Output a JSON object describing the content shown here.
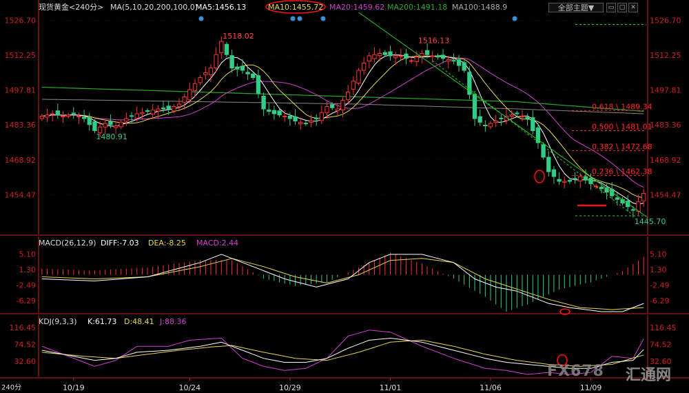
{
  "header": {
    "title": "现货黄金<240分>",
    "ma_params": "MA(5,10,20,200,100,0)",
    "ma5": "MA5:1456.13",
    "ma10": "MA10:1455.72",
    "ma20": "MA20:1459.62",
    "ma200": "MA200:1491.18",
    "ma100": "MA100:1488.9",
    "theme_button": "全部主题▼"
  },
  "macd_header": {
    "params": "MACD(26,12,9)",
    "diff": "DIFF:-7.03",
    "dea": "DEA:-8.25",
    "macd": "MACD:2.44"
  },
  "kdj_header": {
    "params": "KDJ(9,3,3)",
    "k": "K:61.73",
    "d": "D:48.41",
    "j": "J:88.36"
  },
  "period_label": "240分",
  "watermark": {
    "text": "FX678",
    "cn": "汇通网"
  },
  "colors": {
    "up": "#ff3333",
    "down": "#33cc88",
    "ma5": "#ffffff",
    "ma10": "#e8d84a",
    "ma20": "#d040d0",
    "ma200": "#2aaa2a",
    "ma100": "#888888",
    "axis": "#cc2222",
    "annot": "#ff2a2a"
  },
  "chart_data": [
    {
      "type": "candlestick",
      "title": "现货黄金<240分>",
      "y_ticks": [
        1526.7,
        1512.25,
        1497.81,
        1483.36,
        1468.92,
        1454.47
      ],
      "y_tick_labels": [
        "1526.70",
        "1512.25",
        "1497.81",
        "1483.36",
        "1468.92",
        "1454.47"
      ],
      "ylim": [
        1440,
        1530
      ],
      "x_tick_labels": [
        {
          "label": "10/19",
          "index": 6
        },
        {
          "label": "10/24",
          "index": 28
        },
        {
          "label": "10/29",
          "index": 47
        },
        {
          "label": "11/01",
          "index": 66
        },
        {
          "label": "11/06",
          "index": 85
        },
        {
          "label": "11/09",
          "index": 104
        }
      ],
      "count": 115,
      "anchors": [
        [
          0,
          1487
        ],
        [
          2,
          1488
        ],
        [
          4,
          1487
        ],
        [
          6,
          1488
        ],
        [
          8,
          1486
        ],
        [
          10,
          1481
        ],
        [
          12,
          1484
        ],
        [
          14,
          1483
        ],
        [
          16,
          1486
        ],
        [
          18,
          1488
        ],
        [
          20,
          1489
        ],
        [
          22,
          1490
        ],
        [
          24,
          1490
        ],
        [
          26,
          1492
        ],
        [
          28,
          1498
        ],
        [
          30,
          1503
        ],
        [
          32,
          1507
        ],
        [
          34,
          1518
        ],
        [
          36,
          1507
        ],
        [
          38,
          1506
        ],
        [
          40,
          1503
        ],
        [
          42,
          1490
        ],
        [
          44,
          1488
        ],
        [
          46,
          1487
        ],
        [
          48,
          1485
        ],
        [
          50,
          1484
        ],
        [
          52,
          1486
        ],
        [
          54,
          1491
        ],
        [
          56,
          1490
        ],
        [
          58,
          1497
        ],
        [
          60,
          1506
        ],
        [
          62,
          1512
        ],
        [
          64,
          1513
        ],
        [
          66,
          1512
        ],
        [
          68,
          1512
        ],
        [
          70,
          1510
        ],
        [
          72,
          1513
        ],
        [
          74,
          1512
        ],
        [
          76,
          1511
        ],
        [
          78,
          1510
        ],
        [
          80,
          1506
        ],
        [
          82,
          1486
        ],
        [
          84,
          1483
        ],
        [
          86,
          1485
        ],
        [
          88,
          1487
        ],
        [
          90,
          1488
        ],
        [
          92,
          1486
        ],
        [
          94,
          1476
        ],
        [
          96,
          1464
        ],
        [
          98,
          1460
        ],
        [
          100,
          1460
        ],
        [
          102,
          1462
        ],
        [
          104,
          1459
        ],
        [
          106,
          1457
        ],
        [
          108,
          1454
        ],
        [
          110,
          1451
        ],
        [
          112,
          1448
        ],
        [
          114,
          1455
        ]
      ],
      "labels": [
        {
          "text": "1518.02",
          "index": 34,
          "price": 1518.02,
          "color": "#ff4444"
        },
        {
          "text": "1480.91",
          "index": 10,
          "price": 1480.91,
          "color": "#33cc88"
        },
        {
          "text": "1516.13",
          "index": 71,
          "price": 1516.13,
          "color": "#ff4444"
        },
        {
          "text": "1445.70",
          "index": 112,
          "price": 1445.7,
          "color": "#33cc88"
        }
      ],
      "fib_levels": [
        {
          "text": "0.618 \\ 1489.34",
          "price": 1489.34
        },
        {
          "text": "0.500 \\ 1481.01",
          "price": 1481.01
        },
        {
          "text": "0.382 \\ 1472.68",
          "price": 1472.68
        },
        {
          "text": "0.236 \\ 1462.38",
          "price": 1462.38
        }
      ],
      "ma200_line": [
        [
          0,
          1499
        ],
        [
          30,
          1497
        ],
        [
          60,
          1495
        ],
        [
          90,
          1493
        ],
        [
          114,
          1489
        ]
      ],
      "ma100_line": [
        [
          0,
          1494
        ],
        [
          30,
          1493
        ],
        [
          60,
          1492
        ],
        [
          90,
          1490
        ],
        [
          114,
          1488
        ]
      ]
    },
    {
      "type": "bar",
      "title": "MACD(26,12,9)",
      "y_ticks": [
        5.1,
        1.3,
        -2.49,
        -6.29
      ],
      "y_tick_labels": [
        "5.10",
        "1.30",
        "-2.49",
        "-6.29"
      ],
      "ylim": [
        -9,
        7
      ],
      "series": [
        {
          "name": "DIFF",
          "anchors": [
            [
              0,
              -1
            ],
            [
              10,
              -1.5
            ],
            [
              20,
              -0.5
            ],
            [
              30,
              3
            ],
            [
              34,
              5
            ],
            [
              40,
              2
            ],
            [
              46,
              -1
            ],
            [
              52,
              -3
            ],
            [
              58,
              -1
            ],
            [
              62,
              3
            ],
            [
              66,
              5
            ],
            [
              72,
              5
            ],
            [
              78,
              3
            ],
            [
              82,
              -1
            ],
            [
              86,
              -3
            ],
            [
              90,
              -4
            ],
            [
              96,
              -7
            ],
            [
              100,
              -8
            ],
            [
              106,
              -9
            ],
            [
              110,
              -9
            ],
            [
              114,
              -7
            ]
          ]
        },
        {
          "name": "DEA",
          "anchors": [
            [
              0,
              -0.5
            ],
            [
              10,
              -1
            ],
            [
              20,
              -0.5
            ],
            [
              30,
              2
            ],
            [
              36,
              4
            ],
            [
              42,
              2
            ],
            [
              48,
              -0.5
            ],
            [
              54,
              -2
            ],
            [
              60,
              0
            ],
            [
              66,
              3.5
            ],
            [
              72,
              4
            ],
            [
              78,
              3
            ],
            [
              84,
              -1
            ],
            [
              90,
              -3.5
            ],
            [
              96,
              -6
            ],
            [
              102,
              -8
            ],
            [
              108,
              -8.5
            ],
            [
              114,
              -8
            ]
          ]
        },
        {
          "name": "MACD",
          "anchors": [
            [
              0,
              0.8
            ],
            [
              10,
              0.6
            ],
            [
              20,
              1
            ],
            [
              30,
              2
            ],
            [
              36,
              2
            ],
            [
              42,
              -0.5
            ],
            [
              48,
              -1.5
            ],
            [
              54,
              -1
            ],
            [
              60,
              1
            ],
            [
              66,
              3
            ],
            [
              72,
              1.5
            ],
            [
              78,
              -0.5
            ],
            [
              84,
              -3
            ],
            [
              88,
              -5
            ],
            [
              92,
              -4
            ],
            [
              98,
              -2
            ],
            [
              104,
              -1
            ],
            [
              110,
              0.5
            ],
            [
              114,
              2.44
            ]
          ]
        }
      ]
    },
    {
      "type": "line",
      "title": "KDJ(9,3,3)",
      "y_ticks": [
        116.45,
        74.52,
        32.6
      ],
      "y_tick_labels": [
        "116.45",
        "74.52",
        "32.60"
      ],
      "ylim": [
        -5,
        125
      ],
      "series": [
        {
          "name": "K",
          "anchors": [
            [
              0,
              60
            ],
            [
              6,
              45
            ],
            [
              10,
              35
            ],
            [
              14,
              40
            ],
            [
              18,
              55
            ],
            [
              24,
              60
            ],
            [
              30,
              70
            ],
            [
              34,
              80
            ],
            [
              38,
              60
            ],
            [
              42,
              40
            ],
            [
              46,
              30
            ],
            [
              50,
              30
            ],
            [
              54,
              40
            ],
            [
              58,
              65
            ],
            [
              62,
              85
            ],
            [
              66,
              90
            ],
            [
              72,
              80
            ],
            [
              78,
              60
            ],
            [
              84,
              40
            ],
            [
              88,
              30
            ],
            [
              92,
              25
            ],
            [
              96,
              20
            ],
            [
              100,
              15
            ],
            [
              104,
              15
            ],
            [
              108,
              30
            ],
            [
              112,
              35
            ],
            [
              114,
              61.73
            ]
          ]
        },
        {
          "name": "D",
          "anchors": [
            [
              0,
              55
            ],
            [
              8,
              45
            ],
            [
              14,
              40
            ],
            [
              20,
              50
            ],
            [
              26,
              60
            ],
            [
              32,
              68
            ],
            [
              36,
              72
            ],
            [
              42,
              55
            ],
            [
              48,
              40
            ],
            [
              54,
              35
            ],
            [
              60,
              55
            ],
            [
              66,
              80
            ],
            [
              72,
              85
            ],
            [
              78,
              70
            ],
            [
              84,
              50
            ],
            [
              90,
              35
            ],
            [
              96,
              25
            ],
            [
              102,
              20
            ],
            [
              108,
              25
            ],
            [
              114,
              48.41
            ]
          ]
        },
        {
          "name": "J",
          "anchors": [
            [
              0,
              70
            ],
            [
              6,
              40
            ],
            [
              10,
              20
            ],
            [
              14,
              35
            ],
            [
              18,
              70
            ],
            [
              24,
              70
            ],
            [
              28,
              85
            ],
            [
              34,
              90
            ],
            [
              38,
              40
            ],
            [
              42,
              20
            ],
            [
              46,
              10
            ],
            [
              50,
              15
            ],
            [
              54,
              40
            ],
            [
              58,
              95
            ],
            [
              62,
              110
            ],
            [
              66,
              105
            ],
            [
              72,
              70
            ],
            [
              78,
              40
            ],
            [
              84,
              15
            ],
            [
              88,
              10
            ],
            [
              92,
              0
            ],
            [
              96,
              5
            ],
            [
              100,
              0
            ],
            [
              104,
              5
            ],
            [
              108,
              45
            ],
            [
              112,
              40
            ],
            [
              114,
              88.36
            ]
          ]
        }
      ]
    }
  ]
}
